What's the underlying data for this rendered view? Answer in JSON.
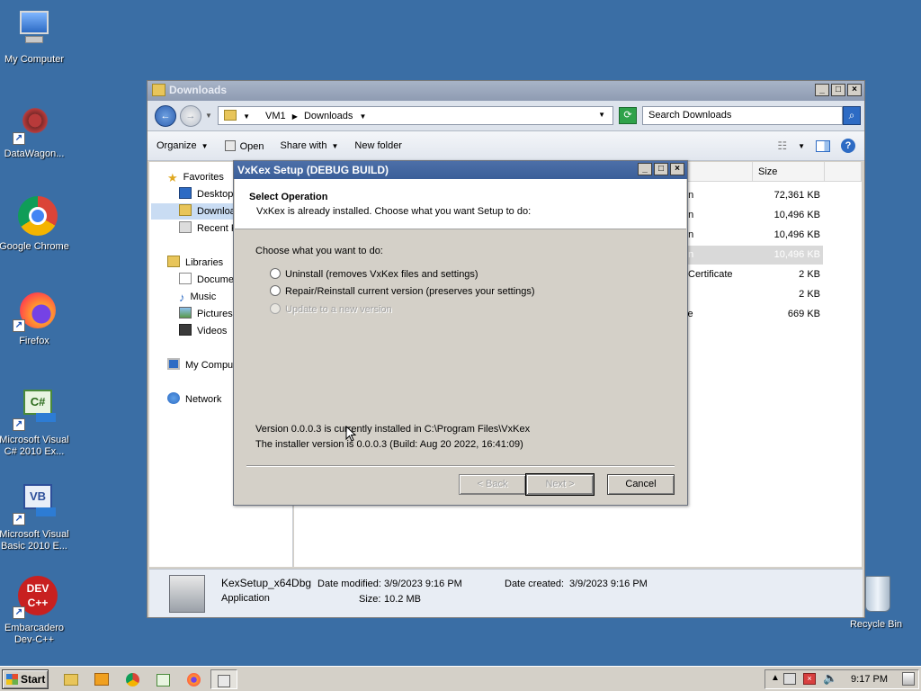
{
  "desktop": {
    "icons": [
      {
        "label": "My Computer"
      },
      {
        "label": "DataWagon..."
      },
      {
        "label": "Google Chrome"
      },
      {
        "label": "Firefox"
      },
      {
        "label": "Microsoft Visual C# 2010 Ex..."
      },
      {
        "label": "Microsoft Visual Basic 2010 E..."
      },
      {
        "label": "Embarcadero Dev-C++"
      },
      {
        "label": "Recycle Bin"
      }
    ]
  },
  "explorer": {
    "title": "Downloads",
    "address": [
      "VM1",
      "Downloads"
    ],
    "search_placeholder": "Search Downloads",
    "toolbar": {
      "organize": "Organize",
      "open": "Open",
      "share": "Share with",
      "new_folder": "New folder"
    },
    "nav": {
      "favorites": "Favorites",
      "desktop": "Desktop",
      "downloads": "Downloa",
      "recent": "Recent P",
      "libraries": "Libraries",
      "documents": "Documer",
      "music": "Music",
      "pictures": "Pictures",
      "videos": "Videos",
      "computer": "My Compu",
      "network": "Network"
    },
    "columns": {
      "size": "Size"
    },
    "rows": [
      {
        "type": "on",
        "size": "72,361 KB"
      },
      {
        "type": "on",
        "size": "10,496 KB"
      },
      {
        "type": "on",
        "size": "10,496 KB"
      },
      {
        "type": "on",
        "size": "10,496 KB"
      },
      {
        "type": "Certificate",
        "size": "2 KB"
      },
      {
        "type": "",
        "size": "2 KB"
      },
      {
        "type": "ve",
        "size": "669 KB"
      }
    ],
    "details": {
      "name": "KexSetup_x64Dbg",
      "kind": "Application",
      "modified_label": "Date modified:",
      "modified": "3/9/2023 9:16 PM",
      "created_label": "Date created:",
      "created": "3/9/2023 9:16 PM",
      "size_label": "Size:",
      "size": "10.2 MB"
    }
  },
  "dialog": {
    "title": "VxKex Setup (DEBUG BUILD)",
    "heading": "Select Operation",
    "subheading": "VxKex is already installed. Choose what you want Setup to do:",
    "prompt": "Choose what you want to do:",
    "options": [
      "Uninstall (removes VxKex files and settings)",
      "Repair/Reinstall current version (preserves your settings)",
      "Update to a new version"
    ],
    "version_installed": "Version 0.0.0.3 is currently installed in C:\\Program Files\\VxKex",
    "installer_version": "The installer version is 0.0.0.3 (Build: Aug 20 2022, 16:41:09)",
    "back": "< Back",
    "next": "Next >",
    "cancel": "Cancel"
  },
  "taskbar": {
    "start": "Start",
    "clock": "9:17 PM"
  }
}
